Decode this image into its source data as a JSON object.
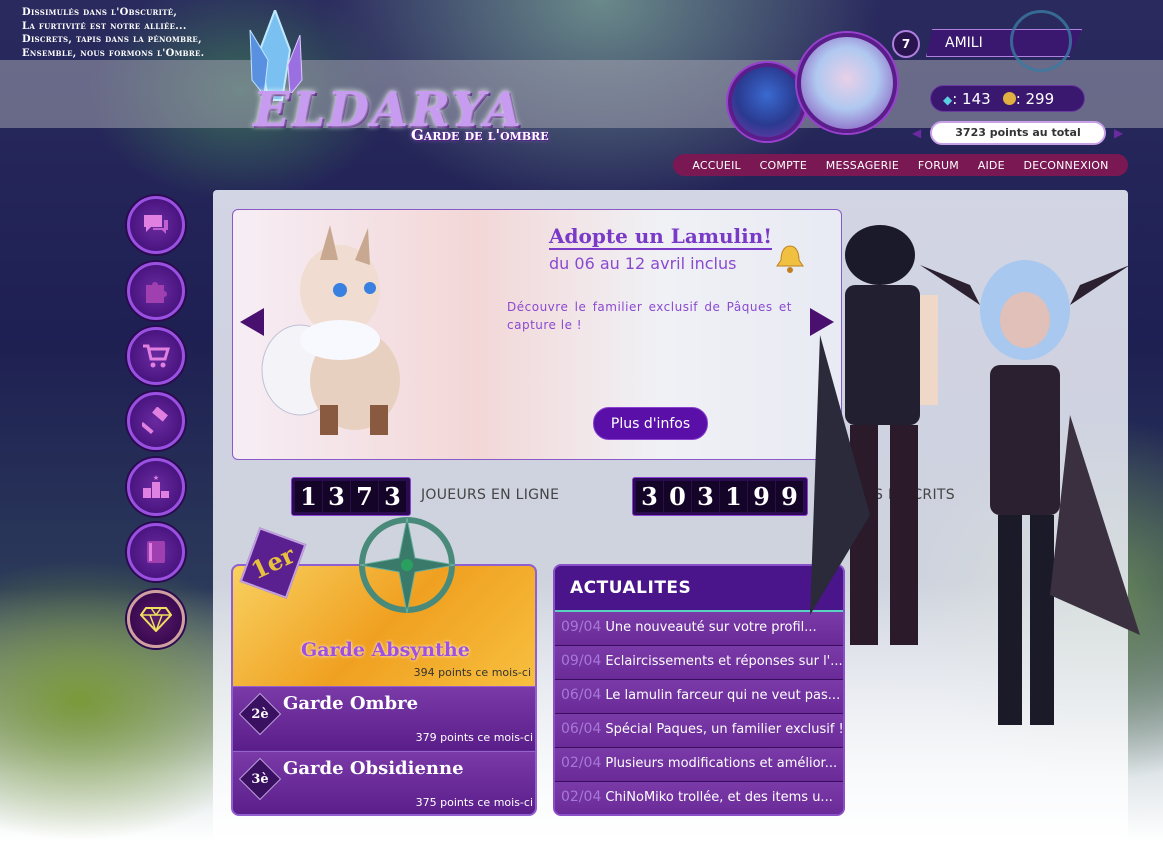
{
  "tagline": [
    "Dissimulés dans l'Obscurité,",
    "La furtivité est notre alliée...",
    "Discrets, tapis dans la pénombre,",
    "Ensemble, nous formons l'Ombre."
  ],
  "logo": {
    "title": "ELDARYA",
    "subtitle": "Garde de l'ombre"
  },
  "user": {
    "level": "7",
    "name": "AMILI",
    "maana": ": 143",
    "gold": ": 299",
    "points_total": "3723 points au total"
  },
  "nav": [
    "ACCUEIL",
    "COMPTE",
    "MESSAGERIE",
    "FORUM",
    "AIDE",
    "DECONNEXION"
  ],
  "sidebar_icons": [
    "chat-icon",
    "puzzle-icon",
    "cart-icon",
    "gavel-icon",
    "podium-icon",
    "book-icon",
    "diamond-icon"
  ],
  "banner": {
    "title": "Adopte un Lamulin!",
    "subtitle": "du 06 au 12 avril inclus",
    "text": "Découvre le familier exclusif de Pâques et capture le !",
    "button": "Plus d'infos"
  },
  "counters": {
    "online_digits": [
      "1",
      "3",
      "7",
      "3"
    ],
    "online_label": "JOUEURS EN LIGNE",
    "total_digits": [
      "3",
      "0",
      "3",
      "1",
      "9",
      "9"
    ],
    "total_label": "JOUEURS INSCRITS"
  },
  "guards": [
    {
      "rank": "1er",
      "name": "Garde Absynthe",
      "points": "394 points ce mois-ci"
    },
    {
      "rank": "2è",
      "name": "Garde Ombre",
      "points": "379 points ce mois-ci"
    },
    {
      "rank": "3è",
      "name": "Garde Obsidienne",
      "points": "375 points ce mois-ci"
    }
  ],
  "news": {
    "title": "ACTUALITES",
    "items": [
      {
        "date": "09/04",
        "text": "Une nouveauté sur votre profil..."
      },
      {
        "date": "09/04",
        "text": "Eclaircissements et réponses sur l'..."
      },
      {
        "date": "06/04",
        "text": "Le lamulin farceur qui ne veut pas..."
      },
      {
        "date": "06/04",
        "text": "Spécial Paques, un familier exclusif !"
      },
      {
        "date": "02/04",
        "text": "Plusieurs modifications et amélior..."
      },
      {
        "date": "02/04",
        "text": "ChiNoMiko trollée, et des items u..."
      }
    ]
  },
  "colors": {
    "accent": "#5a10a8",
    "nav": "#7a1854",
    "news_divider": "#5ad0c0",
    "date": "#a878d8"
  }
}
